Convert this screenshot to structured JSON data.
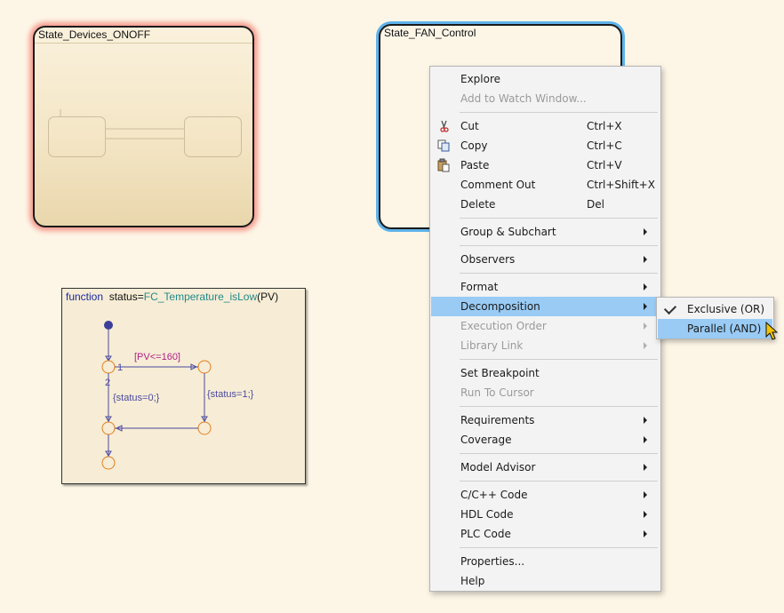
{
  "states": {
    "onoff_title": "State_Devices_ONOFF",
    "fan_title": "State_FAN_Control"
  },
  "function_box": {
    "keyword": "function",
    "output": "status",
    "eq": "=",
    "name": "FC_Temperature_isLow",
    "args": "(PV)",
    "condition": "[PV<=160]",
    "action_true": "{status=1;}",
    "action_false": "{status=0;}",
    "priority_1": "1",
    "priority_2": "2"
  },
  "menu": {
    "explore": "Explore",
    "add_watch": "Add to Watch Window...",
    "cut": "Cut",
    "cut_sc": "Ctrl+X",
    "copy": "Copy",
    "copy_sc": "Ctrl+C",
    "paste": "Paste",
    "paste_sc": "Ctrl+V",
    "comment_out": "Comment Out",
    "comment_out_sc": "Ctrl+Shift+X",
    "delete": "Delete",
    "delete_sc": "Del",
    "group_subchart": "Group & Subchart",
    "observers": "Observers",
    "format": "Format",
    "decomposition": "Decomposition",
    "execution_order": "Execution Order",
    "library_link": "Library Link",
    "set_breakpoint": "Set Breakpoint",
    "run_to_cursor": "Run To Cursor",
    "requirements": "Requirements",
    "coverage": "Coverage",
    "model_advisor": "Model Advisor",
    "cpp_code": "C/C++ Code",
    "hdl_code": "HDL Code",
    "plc_code": "PLC Code",
    "properties": "Properties...",
    "help": "Help"
  },
  "submenu": {
    "exclusive": "Exclusive (OR)",
    "parallel": "Parallel (AND)"
  },
  "colors": {
    "background": "#fdf6e7",
    "selection_highlight": "#99cbf5",
    "state_selected_outline": "#5fb3ea",
    "state_error_glow": "#f05046",
    "junction": "#e08020",
    "default_transition_dot": "#3b3f9a"
  }
}
